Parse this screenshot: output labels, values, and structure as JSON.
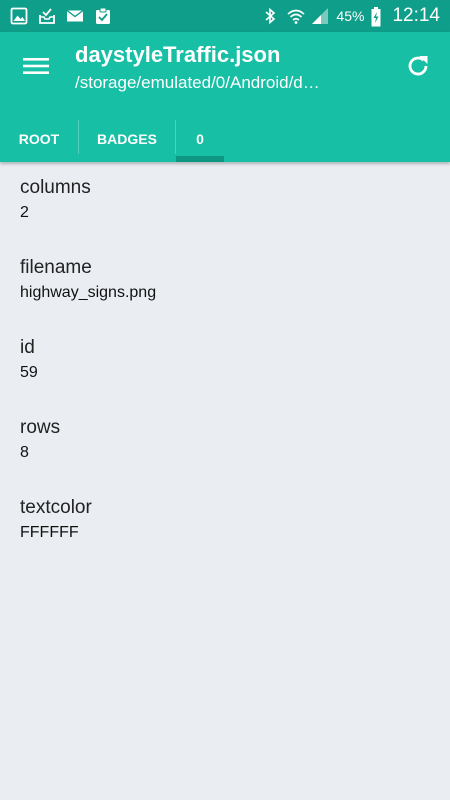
{
  "status_bar": {
    "battery_percent": "45%",
    "time": "12:14",
    "left_icons": [
      "gallery-icon",
      "tray-icon",
      "mail-icon",
      "clipboard-check-icon"
    ],
    "right_icons": [
      "bluetooth-icon",
      "wifi-icon",
      "signal-icon",
      "battery-charging-icon"
    ]
  },
  "app_bar": {
    "title": "daystyleTraffic.json",
    "subtitle": "/storage/emulated/0/Android/d…",
    "menu_icon": "hamburger-menu-icon",
    "refresh_icon": "refresh-icon"
  },
  "tabs": [
    {
      "label": "ROOT",
      "selected": false
    },
    {
      "label": "BADGES",
      "selected": false
    },
    {
      "label": "0",
      "selected": true
    }
  ],
  "fields": [
    {
      "key": "columns",
      "value": "2"
    },
    {
      "key": "filename",
      "value": "highway_signs.png"
    },
    {
      "key": "id",
      "value": "59"
    },
    {
      "key": "rows",
      "value": "8"
    },
    {
      "key": "textcolor",
      "value": "FFFFFF"
    }
  ],
  "colors": {
    "status_bar": "#0f9e89",
    "app_bar": "#17bfa5",
    "tab_indicator": "#0e9683",
    "background": "#eaeef2"
  }
}
